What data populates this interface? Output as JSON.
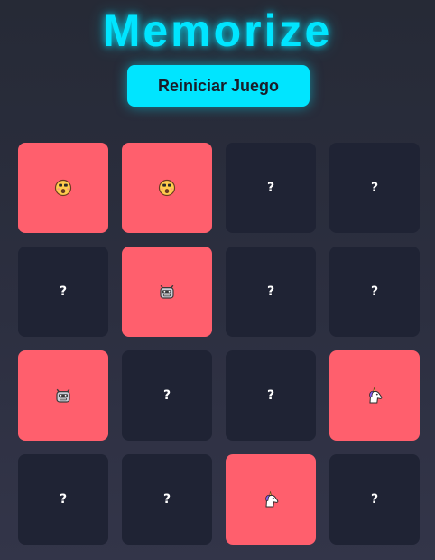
{
  "title": "Memorize",
  "reset_label": "Reiniciar Juego",
  "colors": {
    "accent": "#00e5ff",
    "card_hidden": "#1f2334",
    "card_flipped": "#ff5f6d",
    "background": "#2c2f40"
  },
  "cards": [
    {
      "state": "flipped",
      "label": "",
      "icon": "astonished-face-icon"
    },
    {
      "state": "flipped",
      "label": "",
      "icon": "astonished-face-icon"
    },
    {
      "state": "hidden",
      "label": "?",
      "icon": ""
    },
    {
      "state": "hidden",
      "label": "?",
      "icon": ""
    },
    {
      "state": "hidden",
      "label": "?",
      "icon": ""
    },
    {
      "state": "flipped",
      "label": "",
      "icon": "robot-face-icon"
    },
    {
      "state": "hidden",
      "label": "?",
      "icon": ""
    },
    {
      "state": "hidden",
      "label": "?",
      "icon": ""
    },
    {
      "state": "flipped",
      "label": "",
      "icon": "robot-face-icon"
    },
    {
      "state": "hidden",
      "label": "?",
      "icon": ""
    },
    {
      "state": "hidden",
      "label": "?",
      "icon": ""
    },
    {
      "state": "flipped",
      "label": "",
      "icon": "unicorn-icon"
    },
    {
      "state": "hidden",
      "label": "?",
      "icon": ""
    },
    {
      "state": "hidden",
      "label": "?",
      "icon": ""
    },
    {
      "state": "flipped",
      "label": "",
      "icon": "unicorn-icon"
    },
    {
      "state": "hidden",
      "label": "?",
      "icon": ""
    }
  ]
}
